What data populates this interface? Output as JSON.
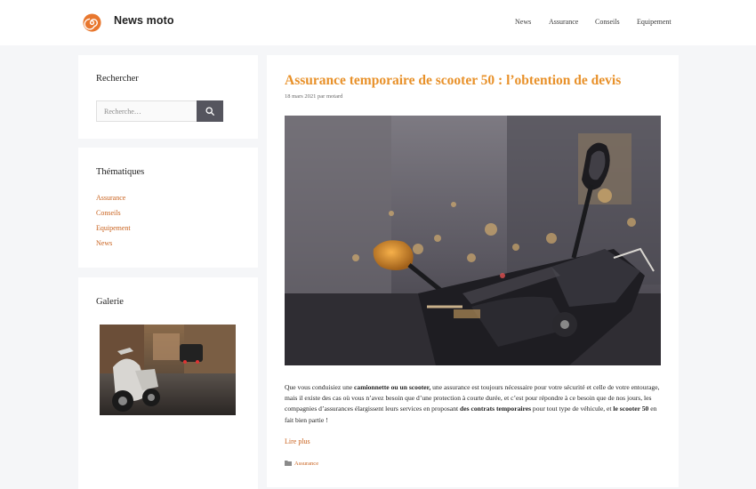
{
  "header": {
    "site_title": "News moto",
    "nav": [
      "News",
      "Assurance",
      "Conseils",
      "Equipement"
    ]
  },
  "sidebar": {
    "search": {
      "title": "Rechercher",
      "placeholder": "Recherche…"
    },
    "categories": {
      "title": "Thématiques",
      "items": [
        "Assurance",
        "Conseils",
        "Equipement",
        "News"
      ]
    },
    "gallery": {
      "title": "Galerie"
    }
  },
  "article": {
    "title": "Assurance temporaire de scooter 50 : l’obtention de devis",
    "date": "18 mars 2021",
    "by": "par",
    "author": "motard",
    "excerpt": {
      "p1": "Que vous conduisiez une ",
      "b1": "camionnette ou un scooter,",
      "p2": " une assurance est toujours nécessaire pour votre sécurité et celle de votre entourage, mais il existe des cas où vous n’avez besoin que d’une protection à courte durée, et c’est pour répondre à ce besoin que de nos jours, les compagnies d’assurances élargissent leurs services en proposant ",
      "b2": "des contrats temporaires",
      "p3": " pour tout type de véhicule, et ",
      "b3": "le scooter 50",
      "p4": " en fait bien partie !"
    },
    "read_more": "Lire plus",
    "category": "Assurance"
  },
  "colors": {
    "accent": "#e8912a",
    "link": "#c9621e",
    "button": "#55555e"
  },
  "icons": {
    "logo": "spiral-logo-icon",
    "search": "search-icon",
    "folder": "folder-icon"
  }
}
